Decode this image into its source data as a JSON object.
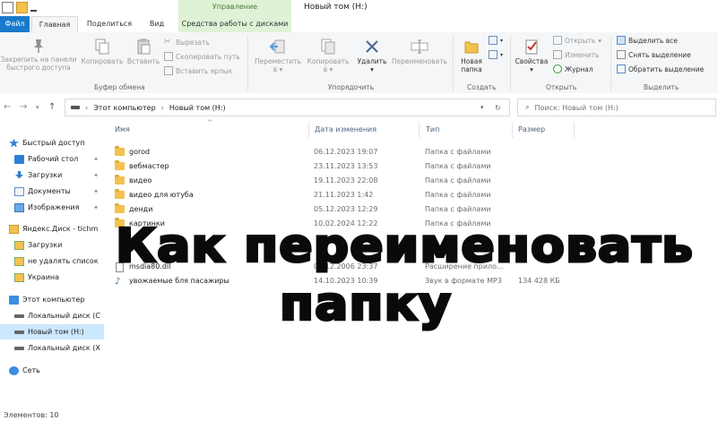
{
  "window": {
    "title": "Новый том (H:)",
    "context_group": "Управление"
  },
  "tabs": {
    "file": "Файл",
    "home": "Главная",
    "share": "Поделиться",
    "view": "Вид",
    "disk_tools": "Средства работы с дисками"
  },
  "ribbon": {
    "clipboard": {
      "pin": "Закрепить на панели быстрого доступа",
      "pin_l1": "Закрепить на панели",
      "pin_l2": "быстрого доступа",
      "copy": "Копировать",
      "paste": "Вставить",
      "cut": "Вырезать",
      "copy_path": "Скопировать путь",
      "paste_shortcut": "Вставить ярлык",
      "label": "Буфер обмена"
    },
    "organize": {
      "move_l1": "Переместить",
      "move_l2": "в",
      "copy_l1": "Копировать",
      "copy_l2": "в",
      "delete": "Удалить",
      "rename": "Переименовать",
      "label": "Упорядочить"
    },
    "create": {
      "new_folder_l1": "Новая",
      "new_folder_l2": "папка",
      "label": "Создать"
    },
    "open": {
      "properties": "Свойства",
      "open": "Открыть",
      "edit": "Изменить",
      "history": "Журнал",
      "label": "Открыть"
    },
    "select": {
      "select_all": "Выделить все",
      "select_none": "Снять выделение",
      "invert": "Обратить выделение",
      "label": "Выделить"
    }
  },
  "address": {
    "root": "Этот компьютер",
    "current": "Новый том (H:)"
  },
  "search": {
    "placeholder": "Поиск: Новый том (H:)"
  },
  "sidebar": {
    "items": [
      {
        "label": "Быстрый доступ",
        "icon": "star-icon"
      },
      {
        "label": "Рабочий стол",
        "icon": "desktop-icon"
      },
      {
        "label": "Загрузки",
        "icon": "download-icon"
      },
      {
        "label": "Документы",
        "icon": "document-icon"
      },
      {
        "label": "Изображения",
        "icon": "image-icon"
      },
      {
        "label": "Яндекс.Диск - tichm",
        "icon": "yandex-disk-icon"
      },
      {
        "label": "Загрузки",
        "icon": "folder-icon"
      },
      {
        "label": "не удалять список",
        "icon": "folder-icon"
      },
      {
        "label": "Украина",
        "icon": "folder-icon"
      },
      {
        "label": "Этот компьютер",
        "icon": "computer-icon"
      },
      {
        "label": "Локальный диск (С",
        "icon": "drive-icon"
      },
      {
        "label": "Новый том (H:)",
        "icon": "drive-icon"
      },
      {
        "label": "Локальный диск (Х",
        "icon": "drive-icon"
      },
      {
        "label": "Сеть",
        "icon": "network-icon"
      }
    ]
  },
  "columns": {
    "name": "Имя",
    "date": "Дата изменения",
    "type": "Тип",
    "size": "Размер"
  },
  "files": [
    {
      "name": "gorod",
      "date": "06.12.2023 19:07",
      "type": "Папка с файлами",
      "size": ""
    },
    {
      "name": "вебмастер",
      "date": "23.11.2023 13:53",
      "type": "Папка с файлами",
      "size": ""
    },
    {
      "name": "видео",
      "date": "19.11.2023 22:08",
      "type": "Папка с файлами",
      "size": ""
    },
    {
      "name": "видео для ютуба",
      "date": "21.11.2023 1:42",
      "type": "Папка с файлами",
      "size": ""
    },
    {
      "name": "денди",
      "date": "05.12.2023 12:29",
      "type": "Папка с файлами",
      "size": ""
    },
    {
      "name": "картинки",
      "date": "10.02.2024 12:22",
      "type": "Папка с файлами",
      "size": ""
    },
    {
      "name": "msdia80.dll",
      "date": "01.12.2006 23:37",
      "type": "Расширение прило...",
      "size": ""
    },
    {
      "name": "увожаемые бля пасажиры",
      "date": "14.10.2023 10:39",
      "type": "Звук в формате MP3",
      "size": "134 428 КБ"
    }
  ],
  "status": {
    "count": "Элементов: 10"
  },
  "overlay": {
    "line1": "Как переименовать",
    "line2": "папку"
  }
}
